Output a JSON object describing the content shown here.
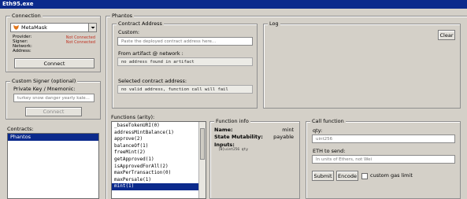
{
  "window": {
    "title": "Eth95.exe"
  },
  "connection": {
    "group_label": "Connection",
    "wallet": "MetaMask",
    "fields": [
      {
        "label": "Provider:",
        "value": "Not Connected"
      },
      {
        "label": "Signer:",
        "value": "Not Connected"
      },
      {
        "label": "Network:",
        "value": ""
      },
      {
        "label": "Address:",
        "value": ""
      }
    ],
    "connect_label": "Connect"
  },
  "signer": {
    "group_label": "Custom Signer (optional)",
    "key_label": "Private Key / Mnemonic:",
    "key_placeholder": "turkey snow danger yearly kale...",
    "connect_label": "Connect"
  },
  "contracts": {
    "label": "Contracts:",
    "items": [
      "Phantos"
    ]
  },
  "phantos": {
    "group_label": "Phantos",
    "contract_address": {
      "group_label": "Contract Address",
      "custom_label": "Custom:",
      "custom_placeholder": "Paste the deployed contract address here...",
      "artifact_label": "From artifact @ network :",
      "artifact_value": "no address found in artifact",
      "selected_label": "Selected contract address:",
      "selected_value": "no valid address, function call will fail"
    },
    "log": {
      "group_label": "Log",
      "clear_label": "Clear"
    },
    "functions": {
      "label": "Functions (arity):",
      "items": [
        "_baseTokenURI(0)",
        "addressMintBalance(1)",
        "approve(2)",
        "balanceOf(1)",
        "freeMint(2)",
        "getApproved(1)",
        "isApprovedForAll(2)",
        "maxPerTransaction(0)",
        "maxPersale(1)",
        "mint(1)"
      ],
      "selected": "mint(1)"
    },
    "function_info": {
      "group_label": "Function info",
      "name_label": "Name:",
      "name_value": "mint",
      "mutability_label": "State Mutability:",
      "mutability_value": "payable",
      "inputs_label": "Inputs:",
      "inputs_value": "[0]uint256 qty"
    },
    "call_function": {
      "group_label": "Call function",
      "qty_label": "qty:",
      "qty_placeholder": "uint256",
      "eth_label": "ETH to send:",
      "eth_placeholder": "In units of Ethers, not Wei",
      "submit_label": "Submit",
      "encode_label": "Encode",
      "custom_gas_label": "custom gas limit"
    }
  }
}
